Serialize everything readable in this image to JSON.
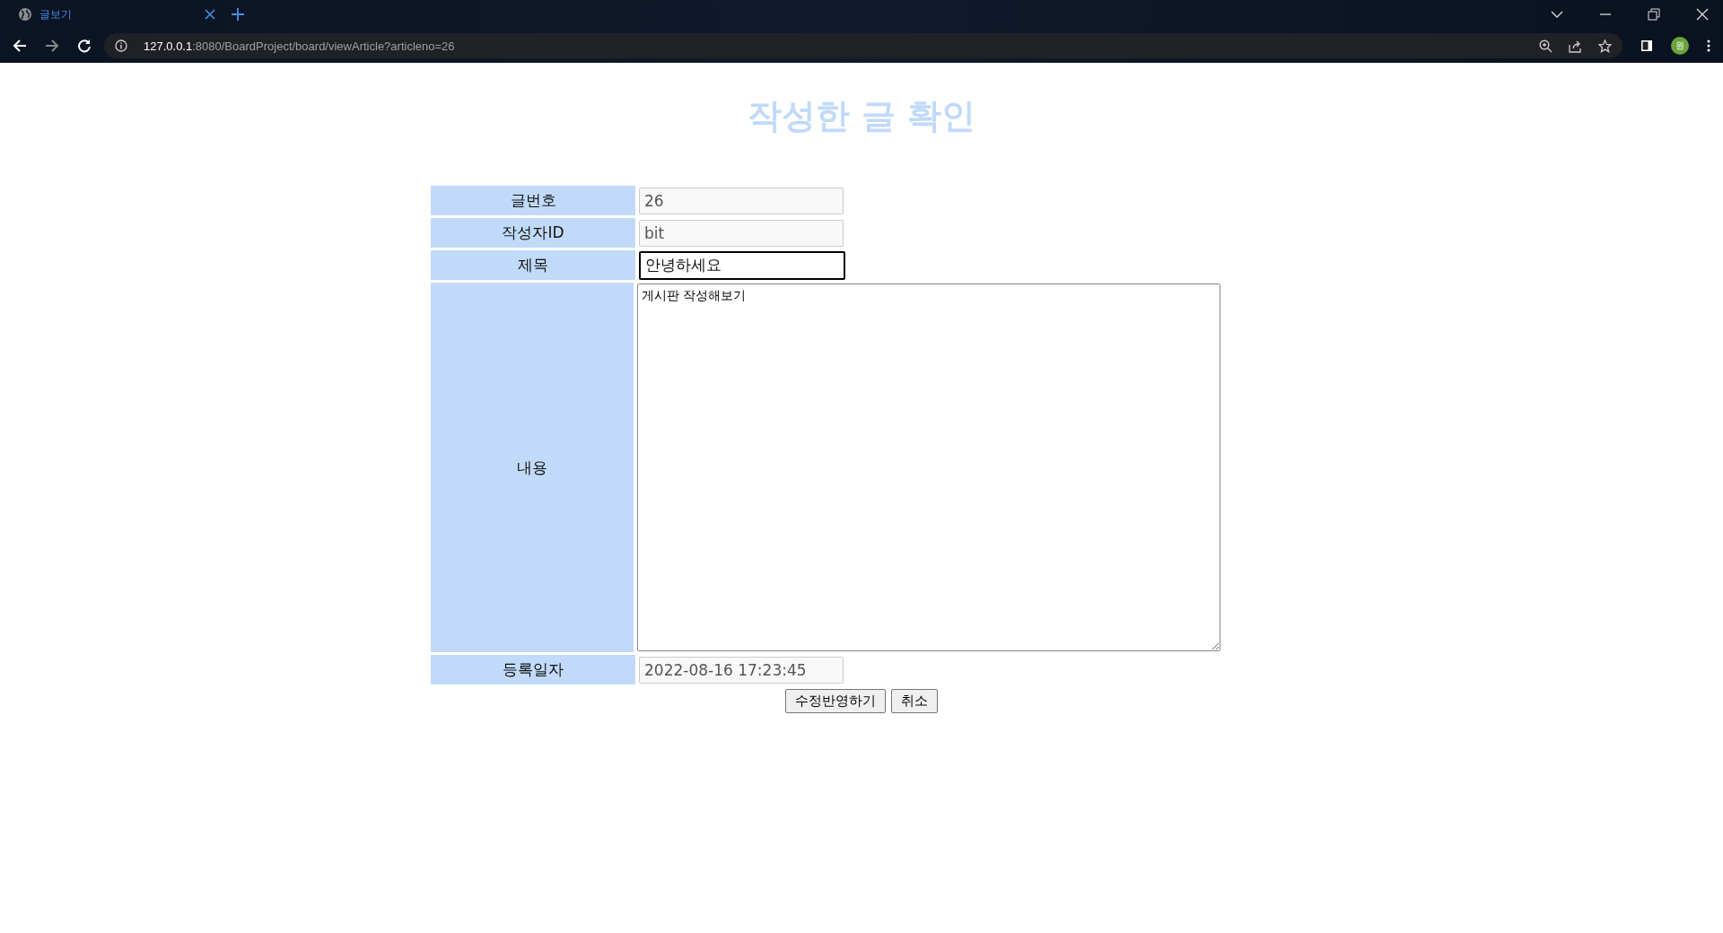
{
  "browser": {
    "tab_title": "글보기",
    "url_host": "127.0.0.1",
    "url_rest": ":8080/BoardProject/board/viewArticle?articleno=26",
    "profile_initial": "원"
  },
  "heading": "작성한 글 확인",
  "fields": [
    {
      "label": "글번호",
      "kind": "input",
      "value": "26",
      "readonly": true,
      "focused": false
    },
    {
      "label": "작성자ID",
      "kind": "input",
      "value": "bit",
      "readonly": true,
      "focused": false
    },
    {
      "label": "제목",
      "kind": "input",
      "value": "안녕하세요",
      "readonly": false,
      "focused": true
    },
    {
      "label": "내용",
      "kind": "textarea",
      "value": "게시판 작성해보기",
      "readonly": false,
      "focused": false
    },
    {
      "label": "등록일자",
      "kind": "input",
      "value": "2022-08-16 17:23:45",
      "readonly": true,
      "focused": false
    }
  ],
  "buttons": [
    "수정반영하기",
    "취소"
  ]
}
